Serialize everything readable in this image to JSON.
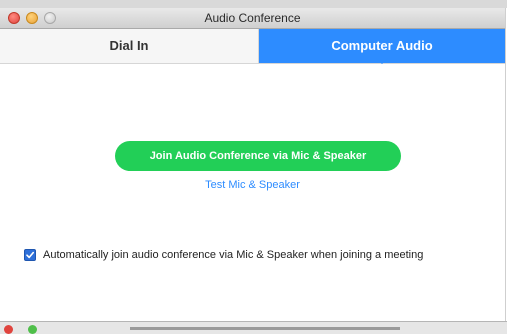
{
  "window": {
    "title": "Audio Conference"
  },
  "tabs": [
    {
      "label": "Dial In",
      "active": false
    },
    {
      "label": "Computer Audio",
      "active": true
    }
  ],
  "main": {
    "join_button_label": "Join Audio Conference via Mic & Speaker",
    "test_link_label": "Test Mic & Speaker"
  },
  "options": {
    "auto_join": {
      "label": "Automatically join audio conference via Mic & Speaker when joining a meeting",
      "checked": true
    }
  },
  "colors": {
    "accent": "#2d8cff",
    "join_button": "#22cf57"
  },
  "icons": {
    "close": "close-icon",
    "minimize": "minimize-icon",
    "zoom": "zoom-icon",
    "checkmark": "checkmark-icon"
  }
}
